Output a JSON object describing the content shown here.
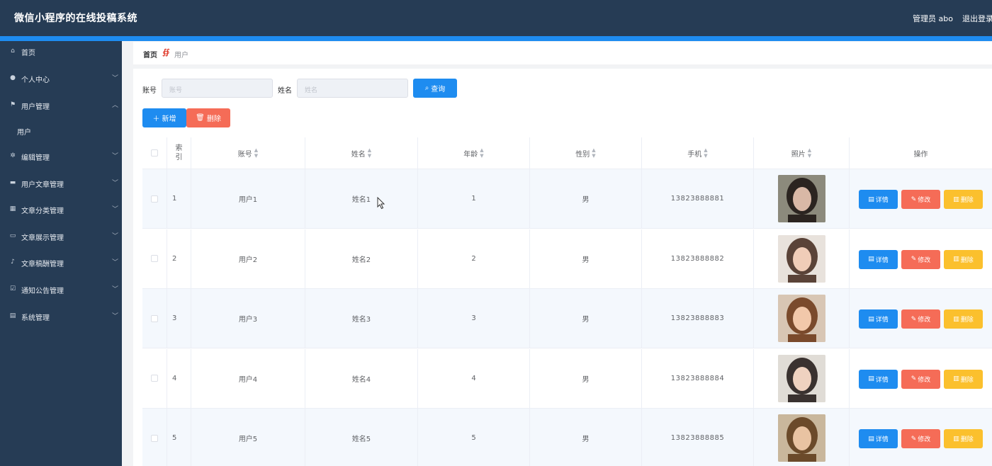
{
  "header": {
    "title": "微信小程序的在线投稿系统",
    "user": "管理员 abo",
    "logout": "退出登录"
  },
  "sidebar": {
    "items": [
      {
        "label": "首页",
        "icon": "home-icon",
        "glyph": "⌂",
        "chevron": false
      },
      {
        "label": "个人中心",
        "icon": "person-icon",
        "glyph": "●",
        "chevron": true
      },
      {
        "label": "用户管理",
        "icon": "flag-icon",
        "glyph": "⚑",
        "chevron": true,
        "expanded": true
      },
      {
        "label": "用户",
        "sub": true
      },
      {
        "label": "编辑管理",
        "icon": "gear-icon",
        "glyph": "✲",
        "chevron": true
      },
      {
        "label": "用户文章管理",
        "icon": "monitor-icon",
        "glyph": "▬",
        "chevron": true
      },
      {
        "label": "文章分类管理",
        "icon": "grid-icon",
        "glyph": "▦",
        "chevron": true
      },
      {
        "label": "文章展示管理",
        "icon": "ticket-icon",
        "glyph": "▭",
        "chevron": true
      },
      {
        "label": "文章稿酬管理",
        "icon": "microphone-icon",
        "glyph": "♪",
        "chevron": true
      },
      {
        "label": "通知公告管理",
        "icon": "checkbox-icon",
        "glyph": "☑",
        "chevron": true
      },
      {
        "label": "系统管理",
        "icon": "clipboard-icon",
        "glyph": "▤",
        "chevron": true
      }
    ]
  },
  "breadcrumb": {
    "home": "首页",
    "separator": "∯",
    "current": "用户"
  },
  "search": {
    "account_label": "账号",
    "account_placeholder": "账号",
    "name_label": "姓名",
    "name_placeholder": "姓名",
    "query_button": "查询"
  },
  "actions": {
    "add_button": "新增",
    "delete_button": "删除"
  },
  "table": {
    "columns": [
      "索引",
      "账号",
      "姓名",
      "年龄",
      "性别",
      "手机",
      "照片",
      "操作"
    ],
    "rows": [
      {
        "index": "1",
        "account": "用户1",
        "name": "姓名1",
        "age": "1",
        "gender": "男",
        "phone": "13823888881"
      },
      {
        "index": "2",
        "account": "用户2",
        "name": "姓名2",
        "age": "2",
        "gender": "男",
        "phone": "13823888882"
      },
      {
        "index": "3",
        "account": "用户3",
        "name": "姓名3",
        "age": "3",
        "gender": "男",
        "phone": "13823888883"
      },
      {
        "index": "4",
        "account": "用户4",
        "name": "姓名4",
        "age": "4",
        "gender": "男",
        "phone": "13823888884"
      },
      {
        "index": "5",
        "account": "用户5",
        "name": "姓名5",
        "age": "5",
        "gender": "男",
        "phone": "13823888885"
      }
    ],
    "row_buttons": {
      "detail": "详情",
      "edit": "修改",
      "delete": "删除"
    }
  },
  "colors": {
    "header_bg": "#263c55",
    "accent": "#1e8cf0",
    "danger": "#f56c57",
    "warning": "#fbc02d"
  }
}
